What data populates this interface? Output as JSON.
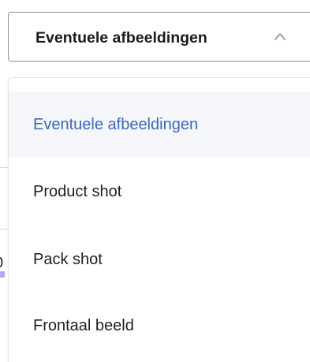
{
  "select": {
    "value": "Eventuele afbeeldingen",
    "expanded": true,
    "icon": "chevron-up-icon"
  },
  "dropdown": {
    "options": [
      {
        "label": "Eventuele afbeeldingen",
        "selected": true
      },
      {
        "label": "Product shot",
        "selected": false
      },
      {
        "label": "Pack shot",
        "selected": false
      },
      {
        "label": "Frontaal beeld",
        "selected": false
      }
    ]
  },
  "background": {
    "fragment_text": "0"
  },
  "colors": {
    "selected_text": "#3a68c4",
    "selected_bg": "#f5f6f9",
    "border": "#8e8e8e",
    "text": "#1f1f1f",
    "bg_pill": "#b9a6ec"
  }
}
